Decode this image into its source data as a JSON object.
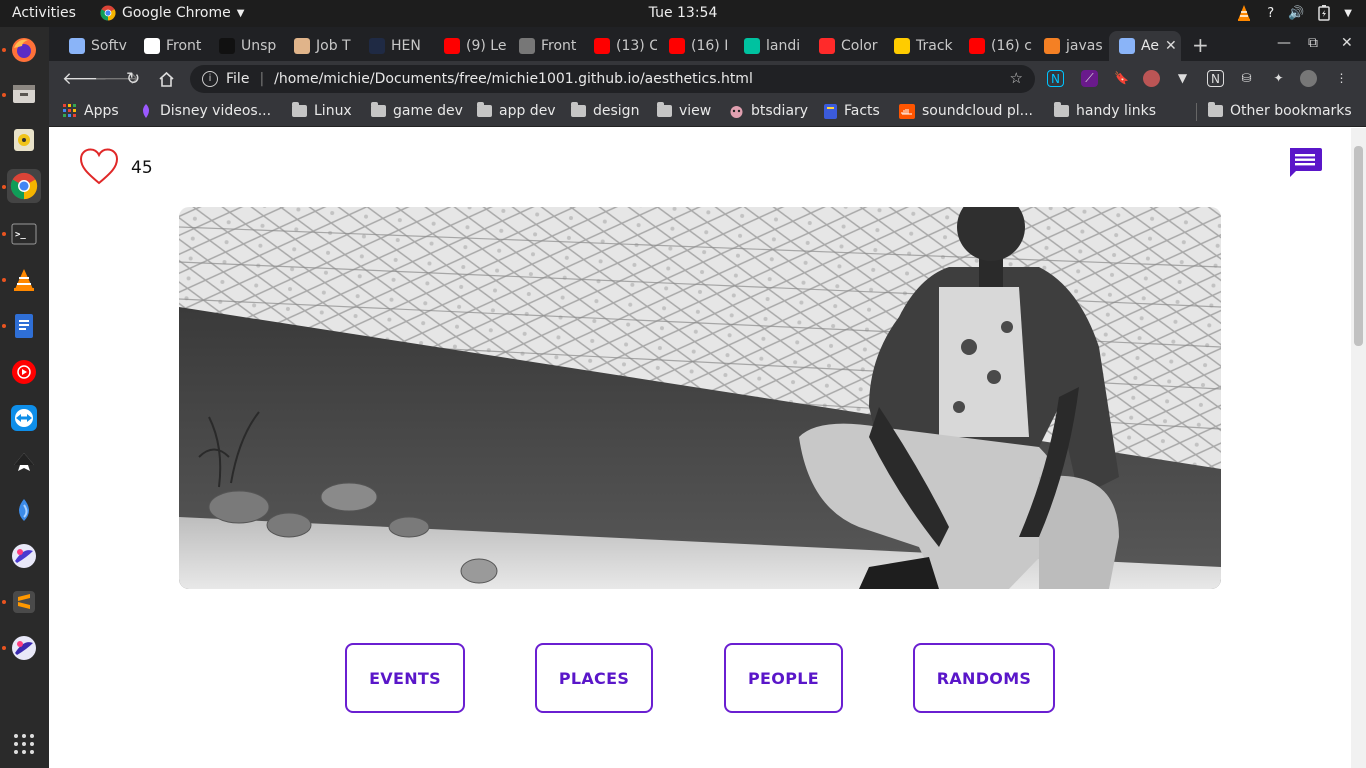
{
  "topbar": {
    "activities": "Activities",
    "app_name": "Google Chrome",
    "clock": "Tue 13:54"
  },
  "tabs": [
    {
      "label": "Softv",
      "color": "#8ab4f8"
    },
    {
      "label": "Front",
      "color": "#ffffff"
    },
    {
      "label": "Unsp",
      "color": "#111111"
    },
    {
      "label": "Job T",
      "color": "#e0b48a"
    },
    {
      "label": "HEN",
      "color": "#1f2a44"
    },
    {
      "label": "(9) Le",
      "color": "#ff0000"
    },
    {
      "label": "Front",
      "color": "#777777"
    },
    {
      "label": "(13) C",
      "color": "#ff0000"
    },
    {
      "label": "(16) I",
      "color": "#ff0000"
    },
    {
      "label": "landi",
      "color": "#00c2a0"
    },
    {
      "label": "Color",
      "color": "#ff2a2a"
    },
    {
      "label": "Track",
      "color": "#ffcc00"
    },
    {
      "label": "(16) c",
      "color": "#ff0000"
    },
    {
      "label": "javas",
      "color": "#f48024"
    },
    {
      "label": "Ae",
      "color": "#8ab4f8"
    }
  ],
  "address": {
    "scheme": "File",
    "url": "/home/michie/Documents/free/michie1001.github.io/aesthetics.html"
  },
  "bookmarks": [
    {
      "label": "Apps"
    },
    {
      "label": "Disney videos..."
    },
    {
      "label": "Linux"
    },
    {
      "label": "game dev"
    },
    {
      "label": "app dev"
    },
    {
      "label": "design"
    },
    {
      "label": "view"
    },
    {
      "label": "btsdiary"
    },
    {
      "label": "Facts"
    },
    {
      "label": "soundcloud pl..."
    },
    {
      "label": "handy links"
    },
    {
      "label": "Other bookmarks"
    }
  ],
  "page": {
    "like_count": "45",
    "categories": [
      "EVENTS",
      "PLACES",
      "PEOPLE",
      "RANDOMS"
    ],
    "accent_color": "#5a16c9"
  }
}
